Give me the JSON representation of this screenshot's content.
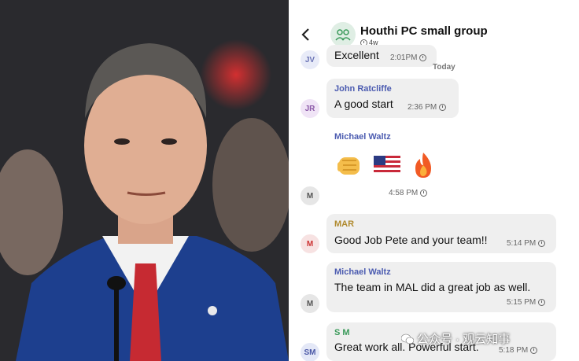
{
  "group": {
    "title": "Houthi PC small group",
    "meta": "4w"
  },
  "messages": [
    {
      "initials": "JV",
      "sender": "",
      "text": "Excellent",
      "time": "2:01PM"
    },
    {
      "separator": "Today"
    },
    {
      "initials": "JR",
      "sender": "John Ratcliffe",
      "text": "A good start",
      "time": "2:36 PM"
    },
    {
      "initials": "M",
      "sender": "Michael Waltz",
      "text": "",
      "time": "4:58 PM"
    },
    {
      "initials": "M",
      "sender": "MAR",
      "text": "Good Job Pete and your team!!",
      "time": "5:14 PM"
    },
    {
      "initials": "M",
      "sender": "Michael Waltz",
      "text": "The team in MAL did a great job  as well.",
      "time": "5:15 PM"
    },
    {
      "initials": "SM",
      "sender": "S M",
      "text": "Great work all. Powerful start.",
      "time": "5:18 PM"
    }
  ],
  "emojis": [
    "fist-emoji",
    "us-flag-emoji",
    "fire-emoji"
  ],
  "watermark": "公众号 · 观云知事",
  "colors": {
    "sender_blue": "#4b5bb0",
    "sender_gold": "#b08a2e",
    "sender_green": "#3a9a5a",
    "bubble": "#efefef"
  }
}
